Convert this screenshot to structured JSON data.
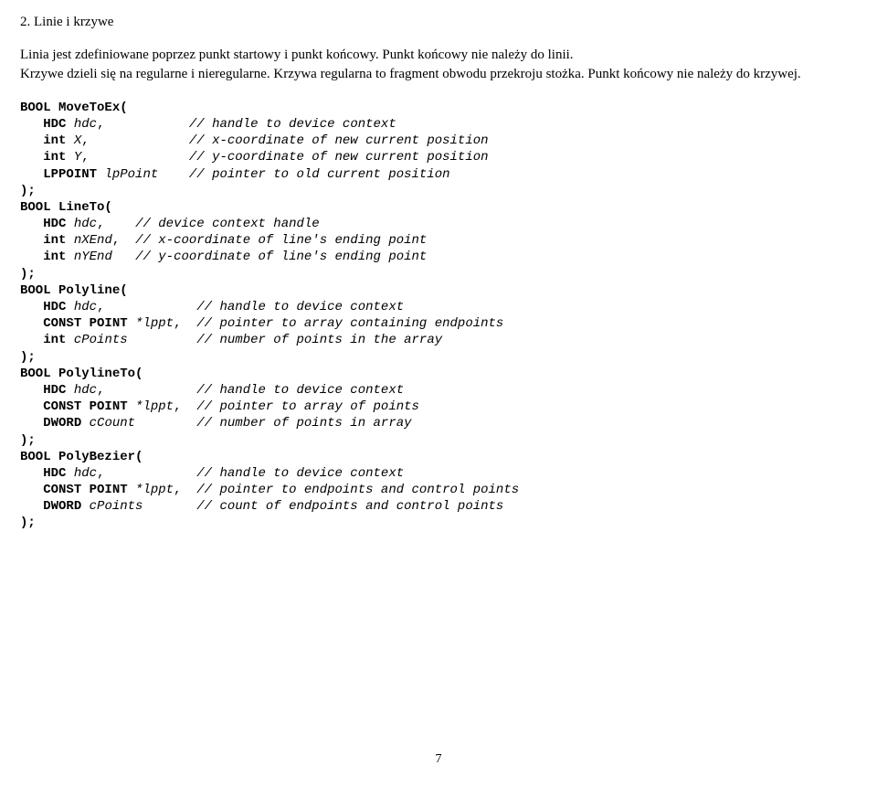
{
  "section": {
    "title": "2.  Linie i krzywe"
  },
  "para": {
    "l1": "Linia jest zdefiniowane poprzez punkt startowy i punkt końcowy. Punkt końcowy nie należy do linii.",
    "l2": "Krzywe dzieli się na regularne i nieregularne. Krzywa regularna to fragment obwodu przekroju stożka. Punkt końcowy nie należy do krzywej."
  },
  "code": {
    "moveToEx": {
      "sig": "BOOL MoveToEx(",
      "p1_decl": "HDC",
      "p1_var": "hdc",
      "p1_c": "// handle to device context",
      "p2_decl": "int",
      "p2_var": "X",
      "p2_c": "// x-coordinate of new current position",
      "p3_decl": "int",
      "p3_var": "Y",
      "p3_c": "// y-coordinate of new current position",
      "p4_decl": "LPPOINT",
      "p4_var": "lpPoint",
      "p4_c": "// pointer to old current position"
    },
    "lineTo": {
      "sig": "BOOL LineTo(",
      "p1_decl": "HDC",
      "p1_var": "hdc",
      "p1_c": "// device context handle",
      "p2_decl": "int",
      "p2_var": "nXEnd",
      "p2_c": "// x-coordinate of line's ending point",
      "p3_decl": "int",
      "p3_var": "nYEnd",
      "p3_c": "// y-coordinate of line's ending point"
    },
    "polyline": {
      "sig": "BOOL Polyline(",
      "p1_decl": "HDC",
      "p1_var": "hdc",
      "p1_c": "// handle to device context",
      "p2_decl": "CONST POINT",
      "p2_var": "*lppt",
      "p2_c": "// pointer to array containing endpoints",
      "p3_decl": "int",
      "p3_var": "cPoints",
      "p3_c": "// number of points in the array"
    },
    "polylineTo": {
      "sig": "BOOL PolylineTo(",
      "p1_decl": "HDC",
      "p1_var": "hdc",
      "p1_c": "// handle to device context",
      "p2_decl": "CONST POINT",
      "p2_var": "*lppt",
      "p2_c": "// pointer to array of points",
      "p3_decl": "DWORD",
      "p3_var": "cCount",
      "p3_c": "// number of points in array"
    },
    "polyBezier": {
      "sig": "BOOL PolyBezier(",
      "p1_decl": "HDC",
      "p1_var": "hdc",
      "p1_c": "// handle to device context",
      "p2_decl": "CONST POINT",
      "p2_var": "*lppt",
      "p2_c": "// pointer to endpoints and control points",
      "p3_decl": "DWORD",
      "p3_var": "cPoints",
      "p3_c": "// count of endpoints and control points"
    },
    "close": ");"
  },
  "page": "7"
}
